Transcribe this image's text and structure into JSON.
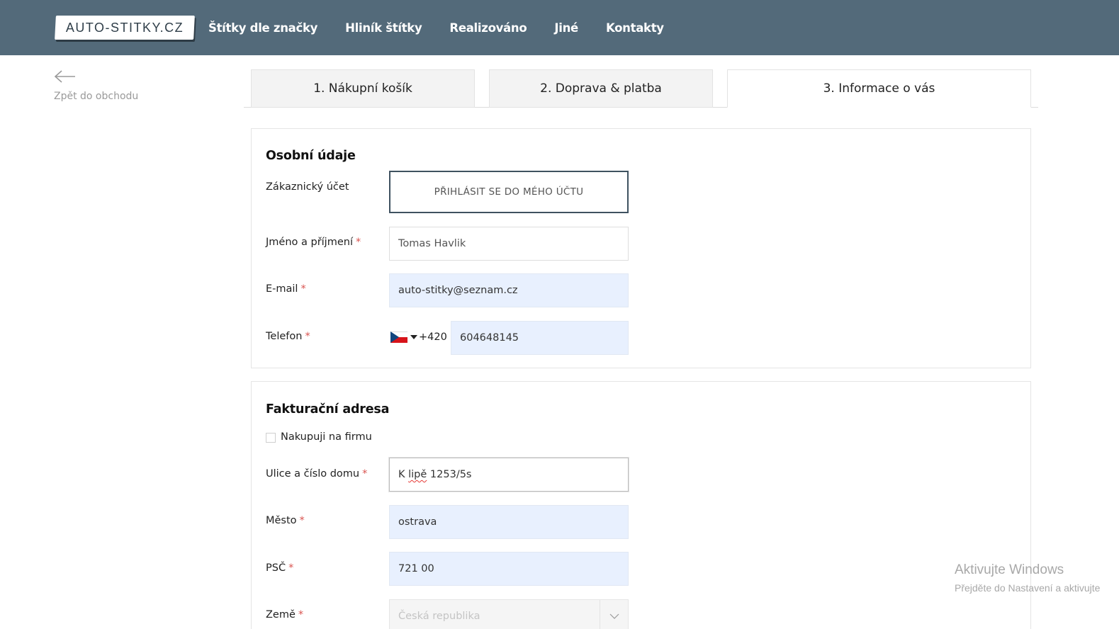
{
  "header": {
    "logo_text": "AUTO-STITKY.CZ",
    "nav": [
      "Štítky dle značky",
      "Hliník štítky",
      "Realizováno",
      "Jiné",
      "Kontakty"
    ],
    "bg_color": "#536a7a"
  },
  "back": {
    "label": "Zpět do obchodu",
    "icon": "arrow-left-icon"
  },
  "tabs": [
    {
      "label": "1. Nákupní košík",
      "active": false
    },
    {
      "label": "2. Doprava & platba",
      "active": false
    },
    {
      "label": "3. Informace o vás",
      "active": true
    }
  ],
  "personal": {
    "title": "Osobní údaje",
    "account_label": "Zákaznický účet",
    "login_button": "PŘIHLÁSIT SE DO MÉHO ÚČTU",
    "name_label": "Jméno a příjmení",
    "name_value": "Tomas Havlik",
    "email_label": "E-mail",
    "email_value": "auto-stitky@seznam.cz",
    "phone_label": "Telefon",
    "phone_prefix": "+420",
    "phone_value": "604648145",
    "required_mark": "*"
  },
  "billing": {
    "title": "Fakturační adresa",
    "company_checkbox_label": "Nakupuji na firmu",
    "street_label": "Ulice a číslo domu",
    "street_value_part1": "K ",
    "street_value_misspelled": "lipě",
    "street_value_part2": " 1253/5s",
    "city_label": "Město",
    "city_value": "ostrava",
    "zip_label": "PSČ",
    "zip_value": "721 00",
    "country_label": "Země",
    "country_value": "Česká republika"
  },
  "watermark": {
    "line1": "Aktivujte Windows",
    "line2": "Přejděte do Nastavení a aktivujte"
  }
}
